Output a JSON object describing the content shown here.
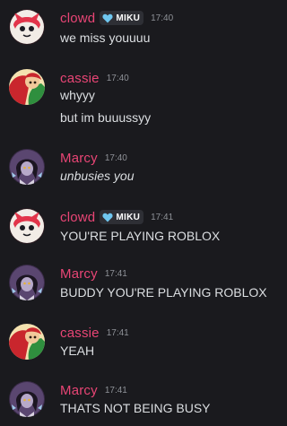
{
  "colors": {
    "background": "#1a1a1e",
    "username": "#e84575",
    "text": "#dbdee1",
    "timestamp": "#8e9197",
    "tag_bg": "#2e2f35",
    "tag_heart": "#6fc7f0"
  },
  "messages": [
    {
      "author": "clowd",
      "tag": "MIKU",
      "tag_icon": "heart-icon",
      "time": "17:40",
      "lines": [
        "we miss youuuu"
      ]
    },
    {
      "author": "cassie",
      "time": "17:40",
      "lines": [
        "whyyy",
        "but im buuussyy"
      ]
    },
    {
      "author": "Marcy",
      "time": "17:40",
      "lines": [
        "unbusies you"
      ]
    },
    {
      "author": "clowd",
      "tag": "MIKU",
      "tag_icon": "heart-icon",
      "time": "17:41",
      "lines": [
        "YOU'RE PLAYING ROBLOX"
      ]
    },
    {
      "author": "Marcy",
      "time": "17:41",
      "lines": [
        "BUDDY YOU'RE PLAYING ROBLOX"
      ]
    },
    {
      "author": "cassie",
      "time": "17:41",
      "lines": [
        "YEAH"
      ]
    },
    {
      "author": "Marcy",
      "time": "17:41",
      "lines": [
        "THATS NOT BEING BUSY"
      ]
    }
  ]
}
